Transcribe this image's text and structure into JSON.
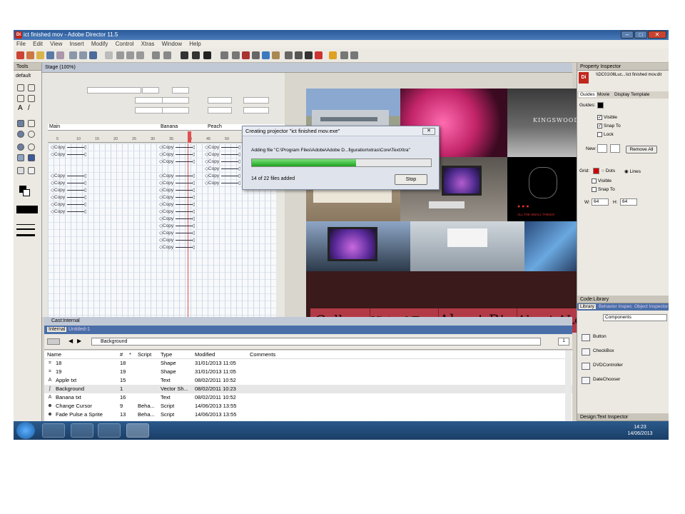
{
  "window": {
    "title": "ict finished mov - Adobe Director 11.5"
  },
  "menu": [
    "File",
    "Edit",
    "View",
    "Insert",
    "Modify",
    "Control",
    "Xtras",
    "Window",
    "Help"
  ],
  "tools": {
    "title": "Tools",
    "mode": "default"
  },
  "stage": {
    "title": "Stage (100%)"
  },
  "score": {
    "channels": [
      "Main",
      "Banana",
      "Peach"
    ],
    "frame_numbers": [
      "5",
      "10",
      "15",
      "20",
      "25",
      "30",
      "35",
      "40",
      "45",
      "50"
    ],
    "sprite_label": "Copy"
  },
  "dialog": {
    "title": "Creating projector \"ict finished mov.exe\"",
    "adding": "Adding file \"C:\\Program Files\\Adobe\\Adobe D...figuration\\xtras\\Core\\TextXtra\"",
    "status": "14 of 22 files added",
    "progress": 0.58,
    "stop_label": "Stop"
  },
  "menu_tiles": [
    "Gallery",
    "Virtual Tour",
    "About Btec",
    "About ALevel"
  ],
  "photo_texts": {
    "kingswood": "KINGSWOOD",
    "poster_tag": "ALL THE SMALL THINGS"
  },
  "cast": {
    "title": "Cast:Internal",
    "tabs": [
      "Internal",
      "Untitled-1"
    ],
    "selected_member": "Background",
    "columns": [
      "Name",
      "#",
      "*",
      "Script",
      "Type",
      "Modified",
      "Comments"
    ],
    "rows": [
      {
        "icon": "⌗",
        "name": "18",
        "num": "18",
        "script": "",
        "type": "Shape",
        "modified": "31/01/2013 11:05"
      },
      {
        "icon": "⌗",
        "name": "19",
        "num": "19",
        "script": "",
        "type": "Shape",
        "modified": "31/01/2013 11:05"
      },
      {
        "icon": "A",
        "name": "Apple txt",
        "num": "15",
        "script": "",
        "type": "Text",
        "modified": "08/02/2011 10:52"
      },
      {
        "icon": "∫",
        "name": "Background",
        "num": "1",
        "script": "",
        "type": "Vector Sh...",
        "modified": "08/02/2011 10:23"
      },
      {
        "icon": "A",
        "name": "Banana txt",
        "num": "16",
        "script": "",
        "type": "Text",
        "modified": "08/02/2011 10:52"
      },
      {
        "icon": "☻",
        "name": "Change Cursor",
        "num": "9",
        "script": "Beha...",
        "type": "Script",
        "modified": "14/06/2013 13:55"
      },
      {
        "icon": "☻",
        "name": "Fade Pulse a Sprite",
        "num": "13",
        "script": "Beha...",
        "type": "Script",
        "modified": "14/06/2013 13:55"
      }
    ]
  },
  "property_inspector": {
    "title": "Property Inspector",
    "path": "\\\\DC01\\06Luc...\\ict finished mov.dir",
    "tabs": [
      "Guides",
      "Movie",
      "Display Template"
    ],
    "guides_label": "Guides:",
    "visible": "Visible",
    "snap_to": "Snap To",
    "lock": "Lock",
    "new_label": "New:",
    "remove_all": "Remove All",
    "grid_label": "Grid:",
    "dots": "Dots",
    "lines": "Lines",
    "grid_visible": "Visible",
    "grid_snap": "Snap To",
    "w_label": "W:",
    "w_value": "64",
    "h_label": "H:",
    "h_value": "64"
  },
  "library": {
    "title": "Code:Library",
    "tabs": [
      "Library",
      "Behavior Inspec",
      "Object Inspector"
    ],
    "category": "Components",
    "items": [
      "Button",
      "CheckBox",
      "DVDController",
      "DateChooser"
    ],
    "bottom_panel": "Design:Text Inspector"
  },
  "taskbar": {
    "time": "14:23",
    "date": "14/06/2013"
  },
  "colors": {
    "titlebar": "#2a5a9a",
    "progress": "#1ea41e",
    "tile": "#b23a46"
  }
}
